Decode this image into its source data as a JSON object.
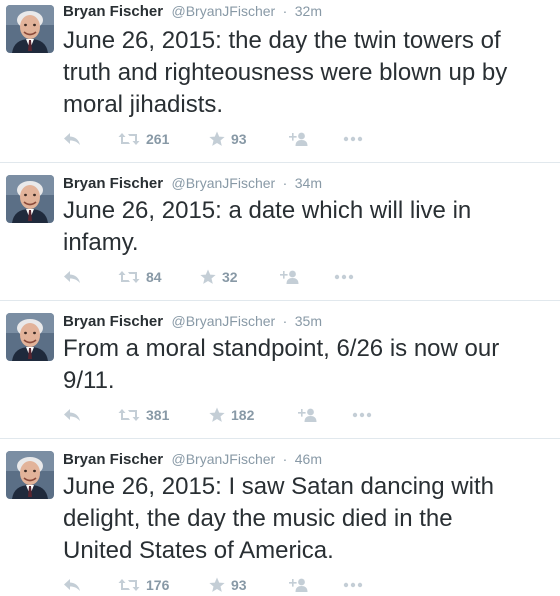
{
  "tweets": [
    {
      "name": "Bryan Fischer",
      "handle": "@BryanJFischer",
      "separator": "·",
      "time": "32m",
      "text": "June 26, 2015: the day the twin towers of\ntruth and righteousness were blown up by\nmoral jihadists.",
      "retweets": "261",
      "favorites": "93"
    },
    {
      "name": "Bryan Fischer",
      "handle": "@BryanJFischer",
      "separator": "·",
      "time": "34m",
      "text": "June 26, 2015: a date which will live in\ninfamy.",
      "retweets": "84",
      "favorites": "32"
    },
    {
      "name": "Bryan Fischer",
      "handle": "@BryanJFischer",
      "separator": "·",
      "time": "35m",
      "text": "From a moral standpoint, 6/26 is now our\n9/11.",
      "retweets": "381",
      "favorites": "182"
    },
    {
      "name": "Bryan Fischer",
      "handle": "@BryanJFischer",
      "separator": "·",
      "time": "46m",
      "text": "June 26, 2015: I saw Satan dancing with\ndelight, the day the music died in the\nUnited States of America.",
      "retweets": "176",
      "favorites": "93"
    }
  ],
  "icons": {
    "reply": "reply-icon",
    "retweet": "retweet-icon",
    "favorite": "star-icon",
    "follow": "add-user-icon",
    "more": "more-icon"
  },
  "colors": {
    "text": "#292f33",
    "muted": "#8899a6",
    "divider": "#e1e8ed"
  }
}
